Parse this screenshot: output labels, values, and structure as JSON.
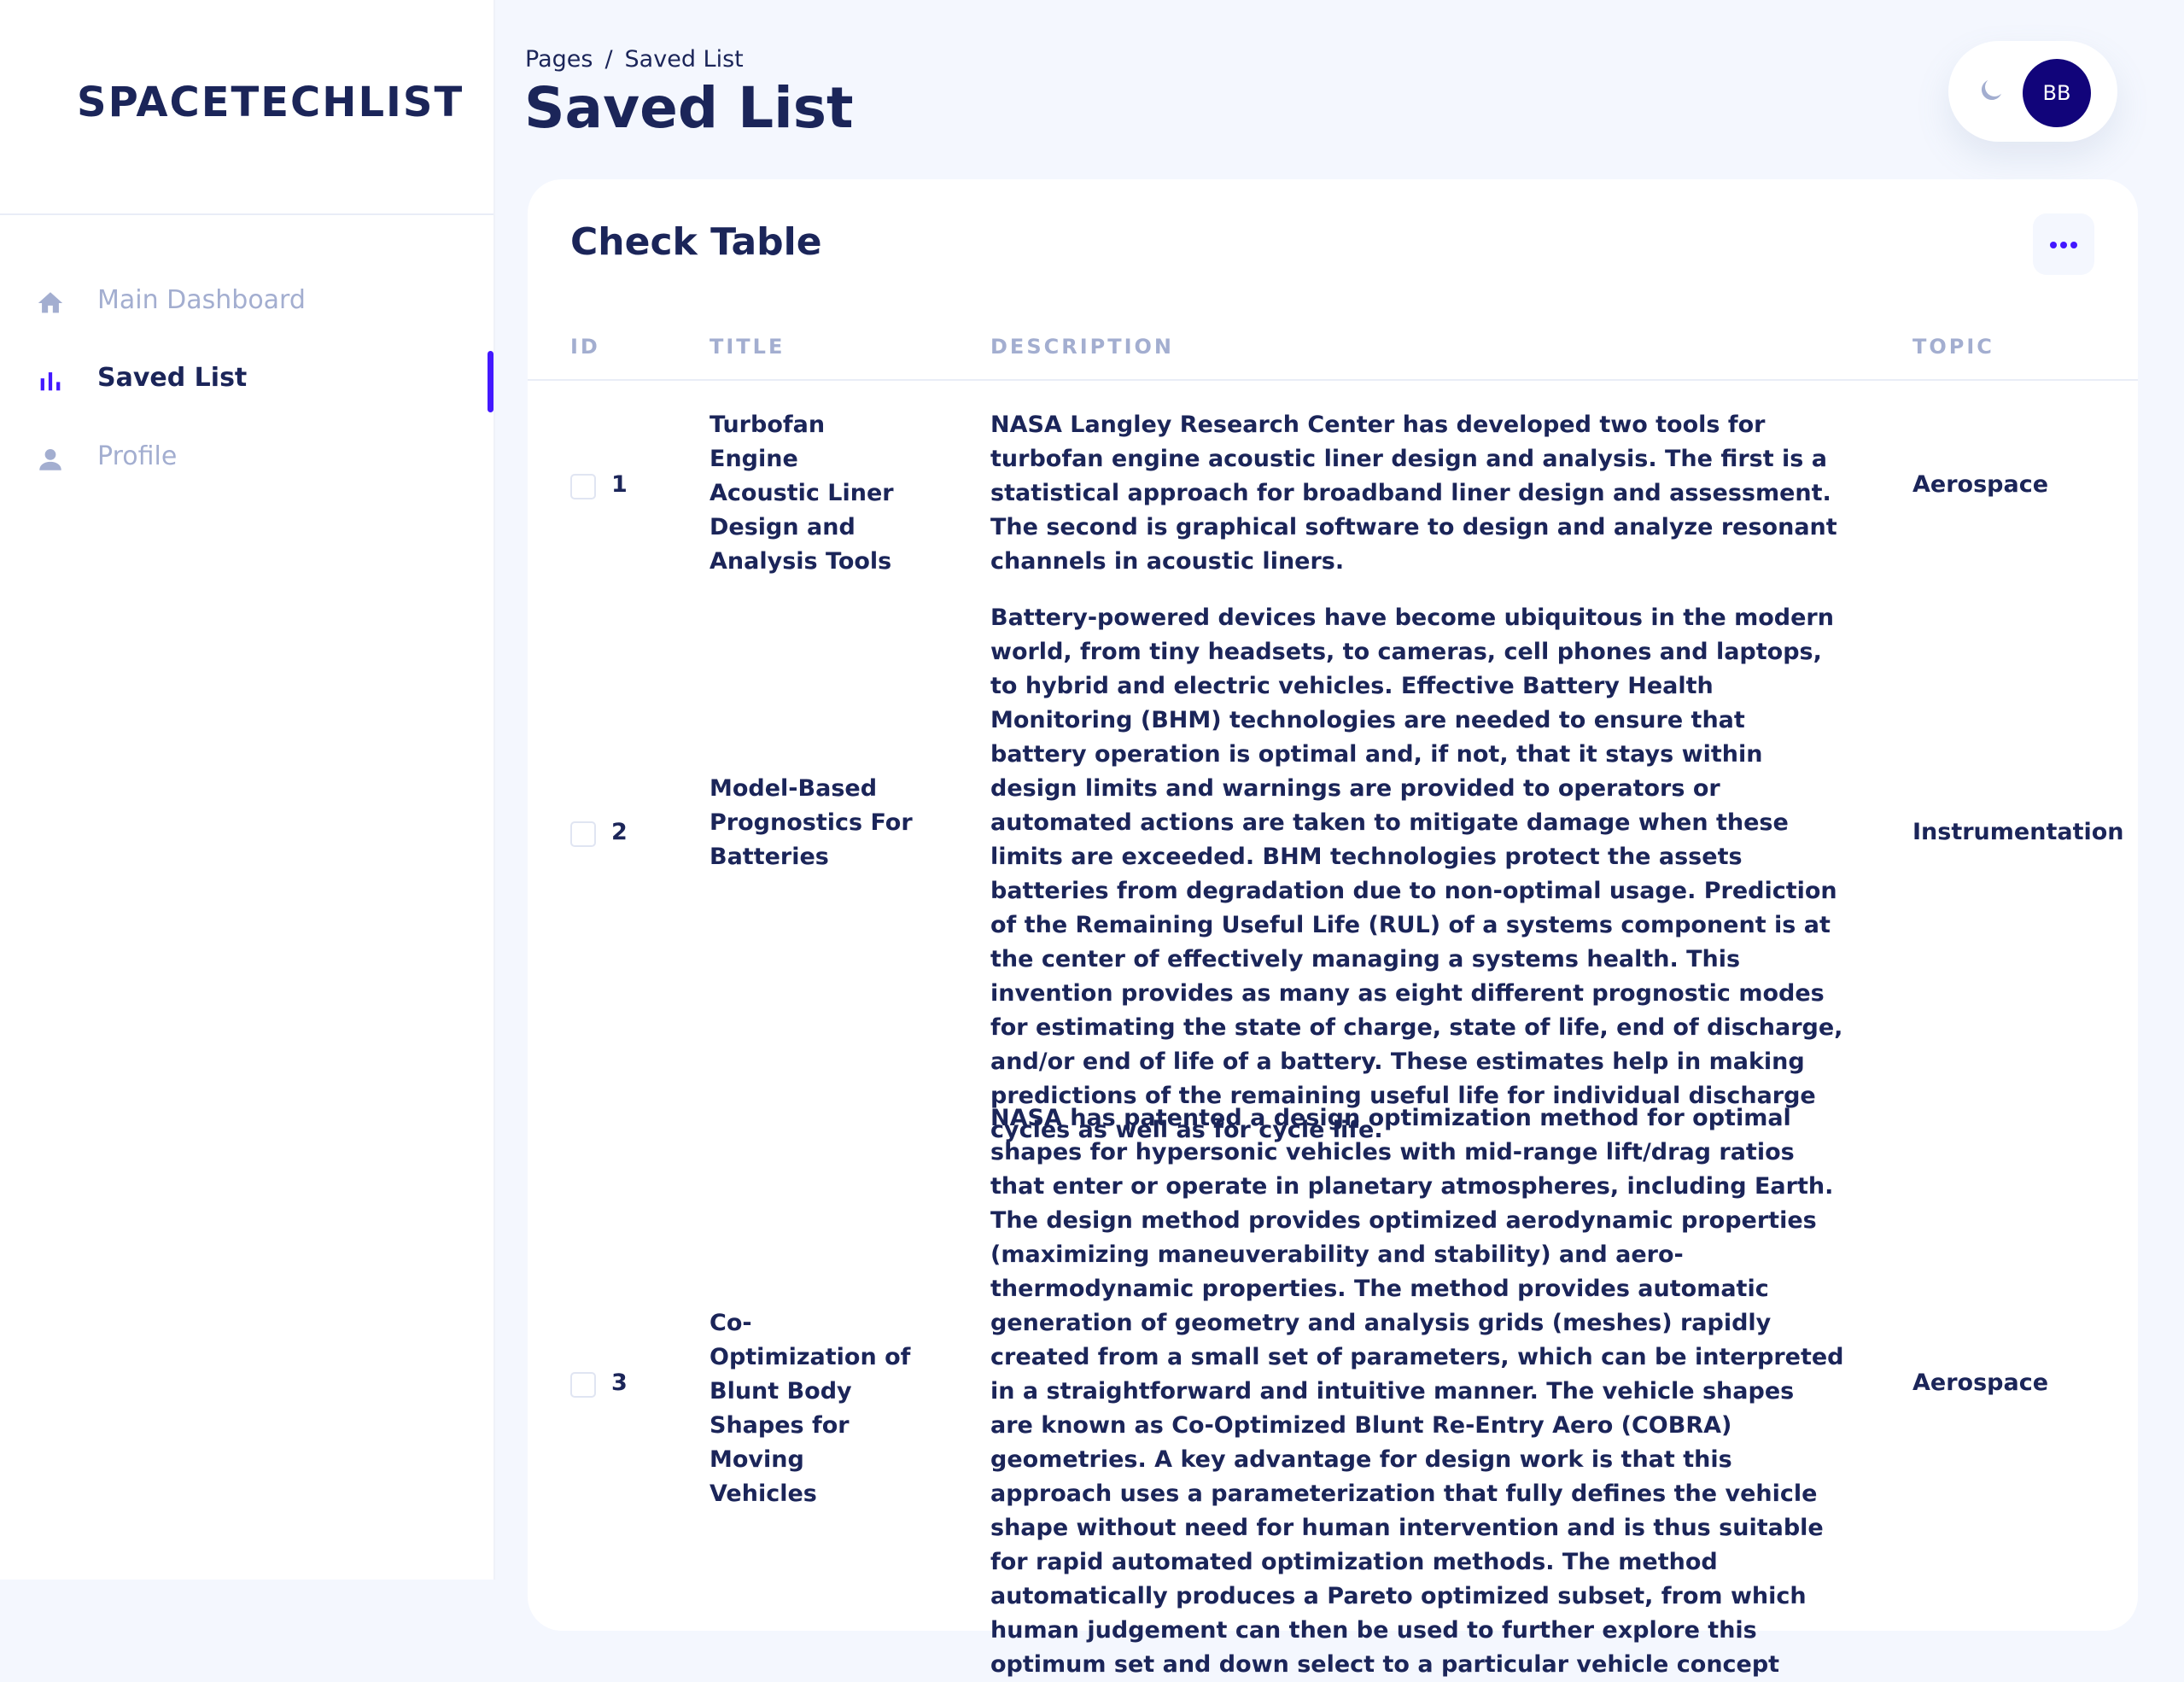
{
  "brand": "SPACETECHLIST",
  "sidebar": {
    "items": [
      {
        "label": "Main Dashboard",
        "icon": "home-icon"
      },
      {
        "label": "Saved List",
        "icon": "bar-chart-icon"
      },
      {
        "label": "Profile",
        "icon": "person-icon"
      }
    ],
    "active": "Saved List"
  },
  "header": {
    "breadcrumb_root": "Pages",
    "breadcrumb_sep": "/",
    "breadcrumb_current": "Saved List",
    "title": "Saved List"
  },
  "user": {
    "initials": "BB",
    "theme_icon": "moon-icon"
  },
  "colors": {
    "accent": "#4318ff",
    "text": "#1b2559",
    "muted": "#a3aed0",
    "avatar": "#11047a",
    "background": "#f4f7fe"
  },
  "card": {
    "title": "Check Table",
    "columns": [
      "ID",
      "TITLE",
      "DESCRIPTION",
      "TOPIC"
    ],
    "rows": [
      {
        "id": "1",
        "title": "Turbofan Engine Acoustic Liner Design and Analysis Tools",
        "description": "NASA Langley Research Center has developed two tools for turbofan engine acoustic liner design and analysis. The first is a statistical approach for broadband liner design and assessment. The second is graphical software to design and analyze resonant channels in acoustic liners.",
        "topic": "Aerospace",
        "checked": false
      },
      {
        "id": "2",
        "title": "Model-Based Prognostics For Batteries",
        "description": "Battery-powered devices have become ubiquitous in the modern world, from tiny headsets, to cameras, cell phones and laptops, to hybrid and electric vehicles. Effective Battery Health Monitoring (BHM) technologies are needed to ensure that battery operation is optimal and, if not, that it stays within design limits and warnings are provided to operators or automated actions are taken to mitigate damage when these limits are exceeded. BHM technologies protect the assets batteries from degradation due to non-optimal usage. Prediction of the Remaining Useful Life (RUL) of a systems component is at the center of effectively managing a systems health. This invention provides as many as eight different prognostic modes for estimating the state of charge, state of life, end of discharge, and/or end of life of a battery. These estimates help in making predictions of the remaining useful life for individual discharge cycles as well as for cycle life.",
        "topic": "Instrumentation",
        "checked": false
      },
      {
        "id": "3",
        "title": "Co-Optimization of Blunt Body Shapes for Moving Vehicles",
        "description": "NASA has patented a design optimization method for optimal shapes for hypersonic vehicles with mid-range lift/drag ratios that enter or operate in planetary atmospheres, including Earth. The design method provides optimized aerodynamic properties (maximizing maneuverability and stability) and aero-thermodynamic properties. The method provides automatic generation of geometry and analysis grids (meshes) rapidly created from a small set of parameters, which can be interpreted in a straightforward and intuitive manner. The vehicle shapes are known as Co-Optimized Blunt Re-Entry Aero (COBRA) geometries. A key advantage for design work is that this approach uses a parameterization that fully defines the vehicle shape without need for human intervention and is thus suitable for rapid automated optimization methods. The method automatically produces a Pareto optimized subset, from which human judgement can then be used to further explore this optimum set and down select to a particular vehicle concept",
        "topic": "Aerospace",
        "checked": false
      }
    ]
  }
}
